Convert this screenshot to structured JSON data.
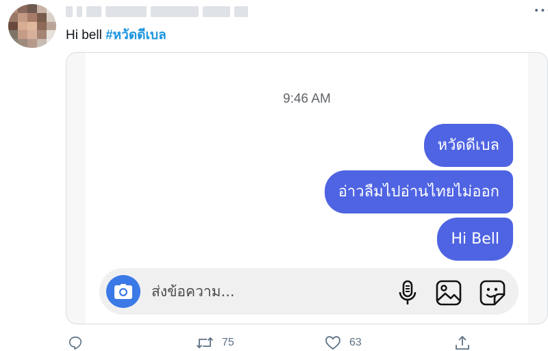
{
  "tweet": {
    "text": "Hi bell ",
    "hashtag": "#หวัดดีเบล"
  },
  "chat": {
    "time": "9:46 AM",
    "messages": [
      "หวัดดีเบล",
      "อ่าวลืมไปอ่านไทยไม่ออก",
      "Hi Bell"
    ],
    "bubble_color": "#4f64e2",
    "composer_placeholder": "ส่งข้อความ...",
    "composer_icons": [
      "camera-icon",
      "microphone-icon",
      "gallery-icon",
      "sticker-icon"
    ]
  },
  "actions": {
    "reply_icon": "reply-icon",
    "retweet_count": "75",
    "like_count": "63",
    "share_icon": "share-icon"
  },
  "colors": {
    "hashtag": "#1b95e0",
    "icon_gray": "#5b7083",
    "camera_button": "#3a79e6"
  }
}
